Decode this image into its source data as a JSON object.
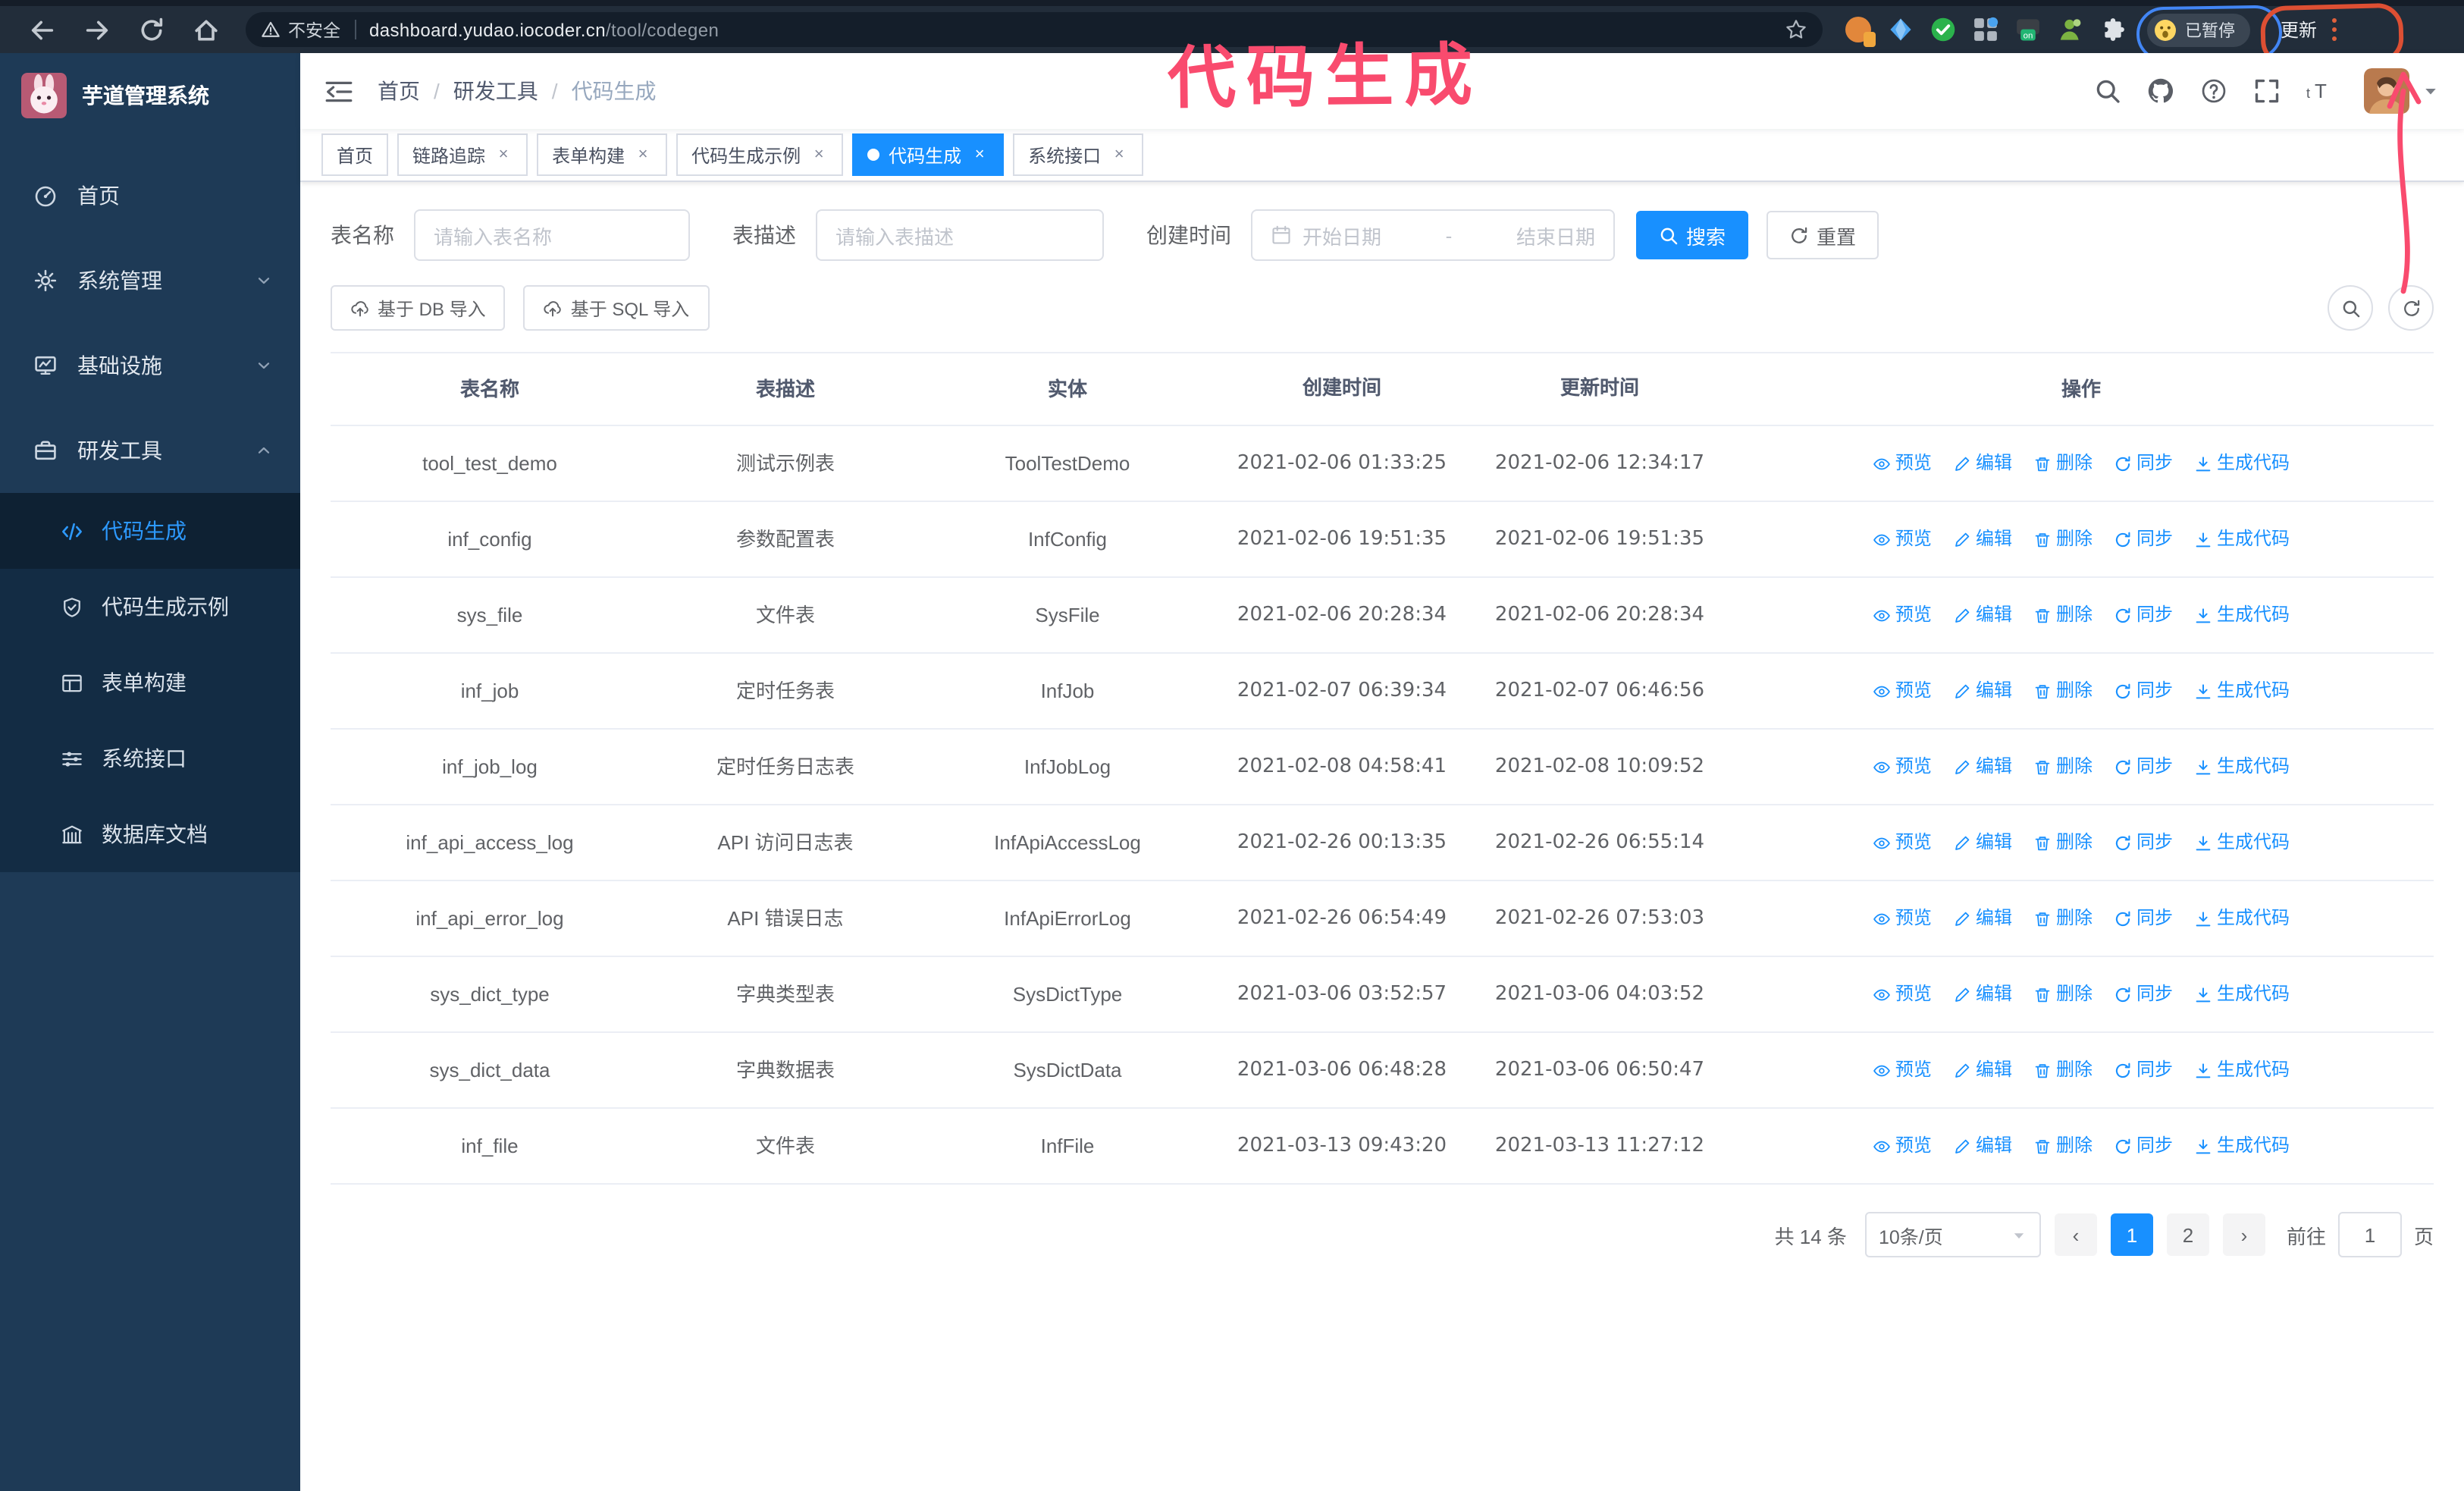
{
  "theme": {
    "primary": "#1890ff",
    "annotation_pink": "#f94b6e",
    "sidebar_bg": "#1e3a56",
    "submenu_bg": "#132c44"
  },
  "annotation": {
    "title": "代码生成"
  },
  "browser": {
    "security_label": "不安全",
    "url_host": "dashboard.yudao.iocoder.cn",
    "url_path": "/tool/codegen",
    "profile_label": "已暂停",
    "update_label": "更新",
    "nav_icons": [
      "back",
      "forward",
      "reload",
      "home"
    ],
    "extension_icons": [
      "ext-orange",
      "ext-gem",
      "ext-check",
      "ext-grid",
      "ext-switch",
      "ext-person",
      "ext-puzzle"
    ]
  },
  "sidebar": {
    "app_title": "芋道管理系统",
    "items": [
      {
        "label": "首页",
        "icon": "dashboard",
        "chevron": ""
      },
      {
        "label": "系统管理",
        "icon": "gear",
        "chevron": "down"
      },
      {
        "label": "基础设施",
        "icon": "monitor",
        "chevron": "down"
      },
      {
        "label": "研发工具",
        "icon": "toolbox",
        "chevron": "up"
      }
    ],
    "submenu": [
      {
        "label": "代码生成",
        "icon": "code",
        "active": true
      },
      {
        "label": "代码生成示例",
        "icon": "shield",
        "active": false
      },
      {
        "label": "表单构建",
        "icon": "form",
        "active": false
      },
      {
        "label": "系统接口",
        "icon": "sliders",
        "active": false
      },
      {
        "label": "数据库文档",
        "icon": "dbdoc",
        "active": false
      }
    ]
  },
  "navbar": {
    "breadcrumb": [
      "首页",
      "研发工具",
      "代码生成"
    ],
    "right_icons": [
      "search",
      "github",
      "help",
      "fullscreen",
      "textsize"
    ]
  },
  "tabs": [
    {
      "label": "首页",
      "closable": false,
      "active": false
    },
    {
      "label": "链路追踪",
      "closable": true,
      "active": false
    },
    {
      "label": "表单构建",
      "closable": true,
      "active": false
    },
    {
      "label": "代码生成示例",
      "closable": true,
      "active": false
    },
    {
      "label": "代码生成",
      "closable": true,
      "active": true
    },
    {
      "label": "系统接口",
      "closable": true,
      "active": false
    }
  ],
  "filters": {
    "table_name_label": "表名称",
    "table_name_placeholder": "请输入表名称",
    "table_desc_label": "表描述",
    "table_desc_placeholder": "请输入表描述",
    "create_time_label": "创建时间",
    "date_start_placeholder": "开始日期",
    "date_separator": "-",
    "date_end_placeholder": "结束日期",
    "search_label": "搜索",
    "reset_label": "重置"
  },
  "toolbar": {
    "import_db_label": "基于 DB 导入",
    "import_sql_label": "基于 SQL 导入"
  },
  "table": {
    "columns": [
      "表名称",
      "表描述",
      "实体",
      "创建时间",
      "更新时间",
      "操作"
    ],
    "actions": [
      {
        "label": "预览",
        "icon": "eye"
      },
      {
        "label": "编辑",
        "icon": "edit"
      },
      {
        "label": "删除",
        "icon": "del"
      },
      {
        "label": "同步",
        "icon": "refresh"
      },
      {
        "label": "生成代码",
        "icon": "download"
      }
    ],
    "rows": [
      {
        "name": "tool_test_demo",
        "description": "测试示例表",
        "entity": "ToolTestDemo",
        "created_at": "2021-02-06 01:33:25",
        "updated_at": "2021-02-06 12:34:17"
      },
      {
        "name": "inf_config",
        "description": "参数配置表",
        "entity": "InfConfig",
        "created_at": "2021-02-06 19:51:35",
        "updated_at": "2021-02-06 19:51:35"
      },
      {
        "name": "sys_file",
        "description": "文件表",
        "entity": "SysFile",
        "created_at": "2021-02-06 20:28:34",
        "updated_at": "2021-02-06 20:28:34"
      },
      {
        "name": "inf_job",
        "description": "定时任务表",
        "entity": "InfJob",
        "created_at": "2021-02-07 06:39:34",
        "updated_at": "2021-02-07 06:46:56"
      },
      {
        "name": "inf_job_log",
        "description": "定时任务日志表",
        "entity": "InfJobLog",
        "created_at": "2021-02-08 04:58:41",
        "updated_at": "2021-02-08 10:09:52"
      },
      {
        "name": "inf_api_access_log",
        "description": "API 访问日志表",
        "entity": "InfApiAccessLog",
        "created_at": "2021-02-26 00:13:35",
        "updated_at": "2021-02-26 06:55:14"
      },
      {
        "name": "inf_api_error_log",
        "description": "API 错误日志",
        "entity": "InfApiErrorLog",
        "created_at": "2021-02-26 06:54:49",
        "updated_at": "2021-02-26 07:53:03"
      },
      {
        "name": "sys_dict_type",
        "description": "字典类型表",
        "entity": "SysDictType",
        "created_at": "2021-03-06 03:52:57",
        "updated_at": "2021-03-06 04:03:52"
      },
      {
        "name": "sys_dict_data",
        "description": "字典数据表",
        "entity": "SysDictData",
        "created_at": "2021-03-06 06:48:28",
        "updated_at": "2021-03-06 06:50:47"
      },
      {
        "name": "inf_file",
        "description": "文件表",
        "entity": "InfFile",
        "created_at": "2021-03-13 09:43:20",
        "updated_at": "2021-03-13 11:27:12"
      }
    ]
  },
  "pagination": {
    "total_label": "共 14 条",
    "page_size_label": "10条/页",
    "prev_label": "‹",
    "next_label": "›",
    "pages": [
      {
        "label": "1",
        "active": true
      },
      {
        "label": "2",
        "active": false
      }
    ],
    "goto_label": "前往",
    "goto_value": "1",
    "page_unit_label": "页"
  }
}
